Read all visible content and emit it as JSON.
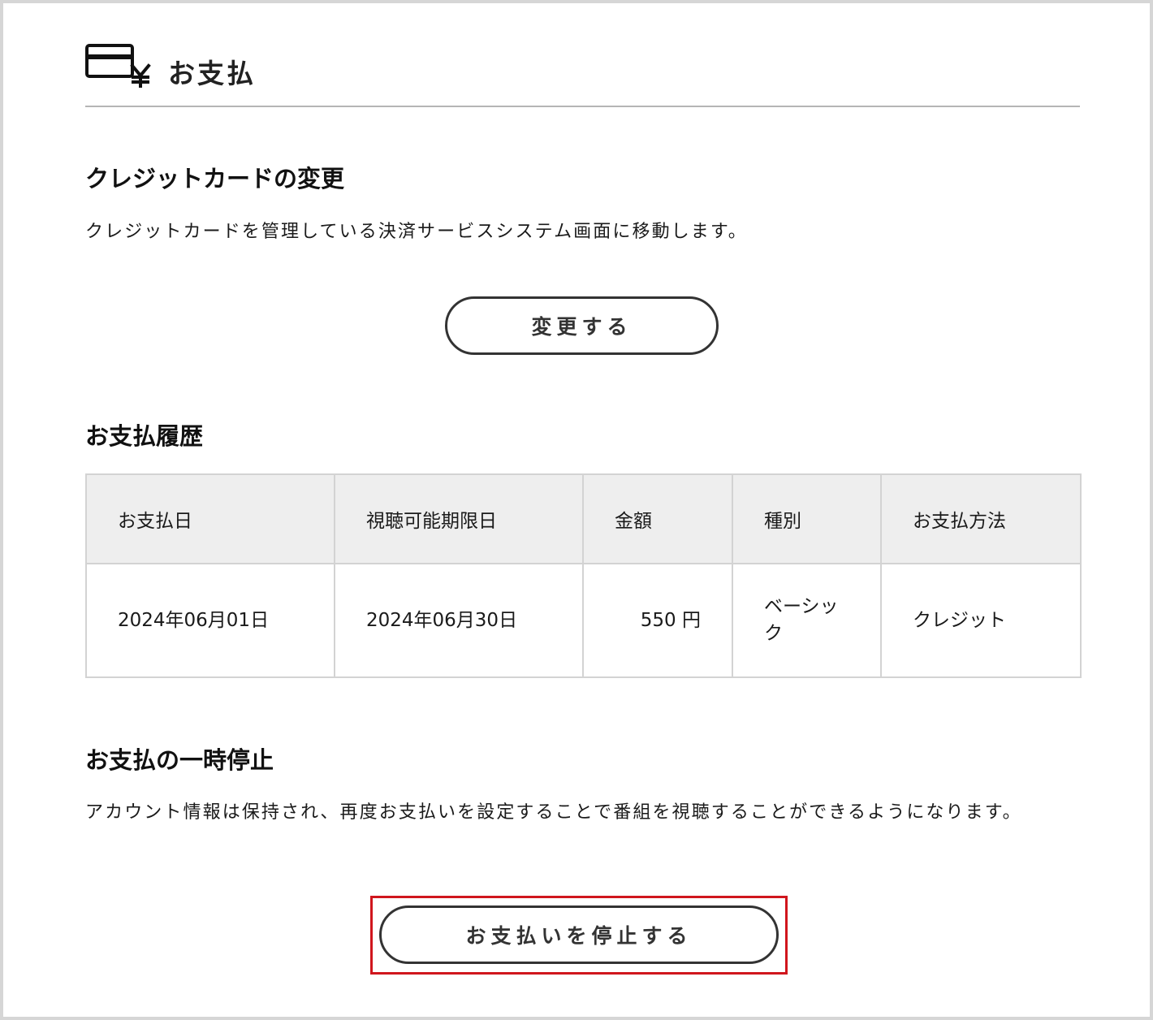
{
  "header": {
    "title": "お支払",
    "icon": "credit-card-yen-icon"
  },
  "card_change": {
    "heading": "クレジットカードの変更",
    "description": "クレジットカードを管理している決済サービスシステム画面に移動します。",
    "button_label": "変更する"
  },
  "history": {
    "heading": "お支払履歴",
    "columns": [
      "お支払日",
      "視聴可能期限日",
      "金額",
      "種別",
      "お支払方法"
    ],
    "rows": [
      {
        "payment_date": "2024年06月01日",
        "expiry_date": "2024年06月30日",
        "amount": "550 円",
        "type": "ベーシック",
        "method": "クレジット"
      }
    ]
  },
  "suspend": {
    "heading": "お支払の一時停止",
    "description": "アカウント情報は保持され、再度お支払いを設定することで番組を視聴することができるようになります。",
    "button_label": "お支払いを停止する",
    "highlight_color": "#d0161d"
  }
}
